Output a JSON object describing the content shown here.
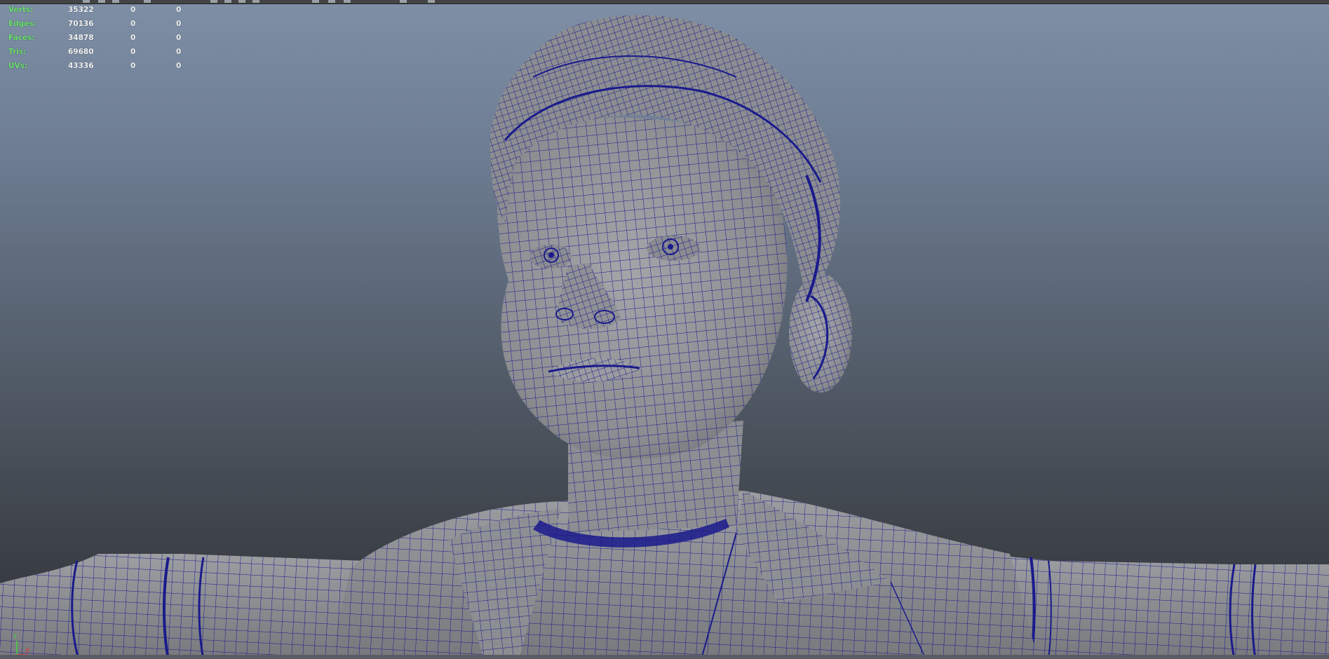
{
  "hud": {
    "rows": [
      {
        "label": "Verts:",
        "values": [
          "35322",
          "0",
          "0"
        ]
      },
      {
        "label": "Edges:",
        "values": [
          "70136",
          "0",
          "0"
        ]
      },
      {
        "label": "Faces:",
        "values": [
          "34878",
          "0",
          "0"
        ]
      },
      {
        "label": "Tris:",
        "values": [
          "69680",
          "0",
          "0"
        ]
      },
      {
        "label": "UVs:",
        "values": [
          "43336",
          "0",
          "0"
        ]
      }
    ]
  },
  "axis": {
    "y_label": "Y",
    "x_label": "X"
  },
  "colors": {
    "wireframe": "#1a1a8c",
    "surface": "#8d8f93",
    "hud_label": "#6fe06f",
    "hud_value": "#f4f4f4",
    "axis_y": "#3fd43f",
    "axis_x": "#e03030"
  }
}
